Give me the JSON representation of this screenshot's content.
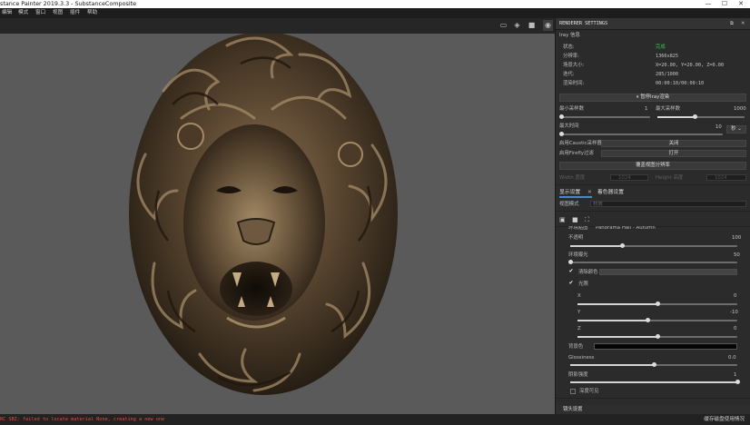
{
  "window": {
    "title": "stance Painter 2019.3.3 - SubstanceComposite",
    "controls": {
      "minimize": "—",
      "maximize": "☐",
      "close": "✕"
    }
  },
  "menu": [
    "编辑",
    "模式",
    "窗口",
    "视图",
    "插件",
    "帮助"
  ],
  "viewport_toolbar": {
    "icons": [
      "rect-select-icon",
      "cube-icon",
      "camera-video-icon",
      "camera-photo-icon"
    ]
  },
  "render_settings": {
    "title": "RENDERER SETTINGS",
    "section": "Iray 信息",
    "info": [
      {
        "label": "状态:",
        "value": "完成",
        "value_color": "#39c04c"
      },
      {
        "label": "分辨率:",
        "value": "1366x825"
      },
      {
        "label": "场景大小:",
        "value": "X=20.00, Y=20.00, Z=0.00"
      },
      {
        "label": "迭代:",
        "value": "285/1000"
      },
      {
        "label": "渲染时间:",
        "value": "00:00:10/00:00:10"
      }
    ],
    "pause_button": "暂停Iray渲染",
    "min_samples": {
      "label": "最小采样数",
      "value": "1",
      "fraction": 0.0
    },
    "max_samples": {
      "label": "最大采样数",
      "value": "1000",
      "fraction": 0.43
    },
    "max_time": {
      "label": "最大时间",
      "value": "10",
      "unit": "秒",
      "fraction": 0.0
    },
    "caustic": {
      "label": "启用Caustic采样器",
      "value": "关闭"
    },
    "firefly": {
      "label": "启用Firefly过滤",
      "value": "打开"
    },
    "override_button": "覆盖视图分辨率",
    "width_label": "Width 宽度",
    "width_value": "1024",
    "height_label": "Height 高度",
    "height_value": "1024"
  },
  "tabs": {
    "display_settings": "显示设置",
    "close": "✕",
    "shader_settings": "着色器设置"
  },
  "display": {
    "view_mode_label": "视图模式",
    "view_mode_value": "材质",
    "environment": {
      "partial_label": "环境贴图",
      "partial_value": "Panorama Hall - Autumn"
    },
    "opacity": {
      "label": "不透明",
      "value": "100",
      "fraction": 0.31
    },
    "exposure": {
      "label": "环境曝光",
      "value": "50",
      "fraction": 0.0
    },
    "blur_color": {
      "label": "清除颜色",
      "checked": true
    },
    "lights": {
      "label": "光照",
      "checked": true
    },
    "x": {
      "label": "X",
      "value": "0",
      "fraction": 0.5
    },
    "y": {
      "label": "Y",
      "value": "-10",
      "fraction": 0.44
    },
    "z": {
      "label": "Z",
      "value": "0",
      "fraction": 0.5
    },
    "bg_color": {
      "label": "背景色",
      "color": "#050505"
    },
    "glossiness": {
      "label": "Glossiness",
      "value": "0.0",
      "fraction": 0.5
    },
    "shadow_strength": {
      "label": "阴影强度",
      "value": "1",
      "fraction": 1.0
    },
    "shadow_visible": {
      "label": "深度可见",
      "checked": false
    },
    "camera_settings": "镜头设置"
  },
  "status": {
    "error": "RC SBZ: failed to locate material None, creating a new one",
    "right": "缓存磁盘使用情况"
  },
  "colors": {
    "accent": "#39c04c",
    "error": "#e0503c",
    "panel": "#2b2b2b",
    "viewport": "#5a5a5a"
  }
}
